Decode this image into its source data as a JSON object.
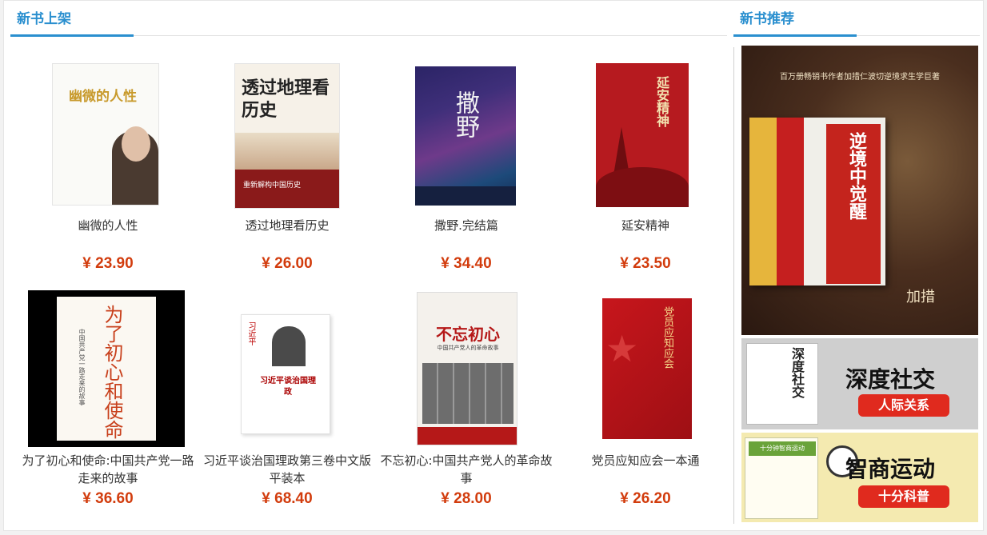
{
  "new_books": {
    "title": "新书上架",
    "items": [
      {
        "title": "幽微的人性",
        "price": "¥ 23.90",
        "cover_text": "幽微的人性"
      },
      {
        "title": "透过地理看历史",
        "price": "¥ 26.00",
        "cover_text": "透过地理看历史",
        "cover_sub": "重新解构中国历史"
      },
      {
        "title": "撒野.完结篇",
        "price": "¥ 34.40",
        "cover_text": "撒野"
      },
      {
        "title": "延安精神",
        "price": "¥ 23.50",
        "cover_text": "延安精神"
      },
      {
        "title": "为了初心和使命:中国共产党一路走来的故事",
        "price": "¥ 36.60",
        "cover_text": "为了初心和使命",
        "cover_sub": "中国共产党一路走来的故事"
      },
      {
        "title": "习近平谈治国理政第三卷中文版平装本",
        "price": "¥ 68.40",
        "cover_text": "习近平谈治国理政",
        "cover_sub": "习近平"
      },
      {
        "title": "不忘初心:中国共产党人的革命故事",
        "price": "¥ 28.00",
        "cover_text": "不忘初心",
        "cover_sub": "中国共产党人的革命故事"
      },
      {
        "title": "党员应知应会一本通",
        "price": "¥ 26.20",
        "cover_text": "党员应知应会"
      }
    ]
  },
  "recommend": {
    "title": "新书推荐",
    "ads": [
      {
        "title": "逆境中觉醒",
        "headline": "百万册畅销书作者加措仁波切逆境求生学巨著",
        "author": "加措"
      },
      {
        "title": "深度社交",
        "sub": "人际关系",
        "cover_text": "深度社交"
      },
      {
        "title": "智商运动",
        "sub": "十分科普",
        "cover_text": "十分钟智商运动"
      }
    ]
  },
  "colors": {
    "accent": "#2a8fcf",
    "price": "#d23c0d"
  }
}
